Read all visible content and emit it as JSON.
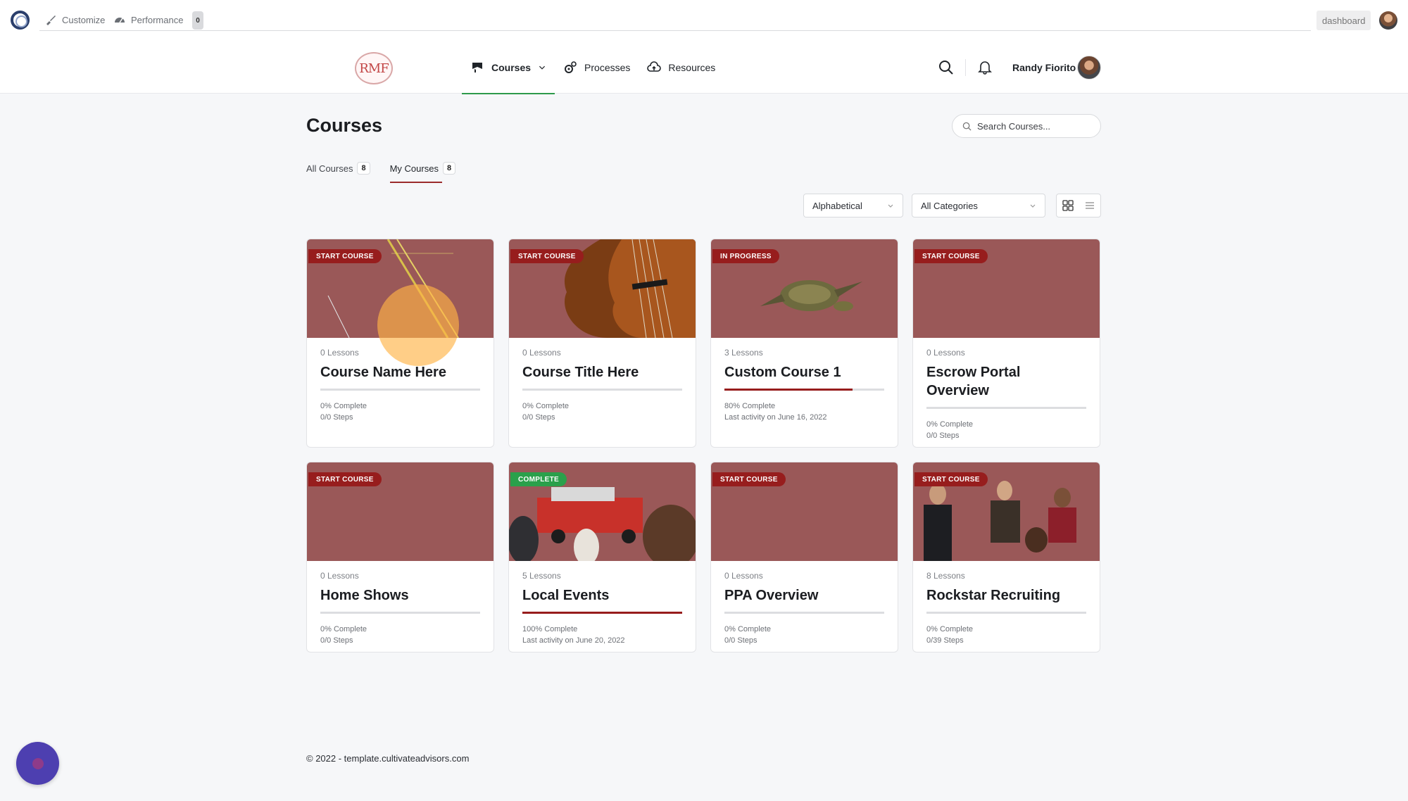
{
  "admin_bar": {
    "customize_label": "Customize",
    "performance_label": "Performance",
    "performance_count": "0",
    "dashboard_label": "dashboard"
  },
  "header": {
    "logo_text": "RMF",
    "nav": [
      {
        "label": "Courses",
        "icon": "courses-icon",
        "active": true
      },
      {
        "label": "Processes",
        "icon": "gears-icon"
      },
      {
        "label": "Resources",
        "icon": "cloud-upload-icon"
      }
    ],
    "user_name": "Randy Fiorito"
  },
  "page": {
    "title": "Courses",
    "search_placeholder": "Search Courses..."
  },
  "tabs": [
    {
      "label": "All Courses",
      "count": "8"
    },
    {
      "label": "My Courses",
      "count": "8",
      "active": true
    }
  ],
  "filters": {
    "sort_selected": "Alphabetical",
    "category_selected": "All Categories"
  },
  "courses": [
    {
      "badge": "START COURSE",
      "lessons": "0 Lessons",
      "title": "Course Name Here",
      "progress": 0,
      "status_line1": "0% Complete",
      "status_line2": "0/0 Steps",
      "thumb": "crane"
    },
    {
      "badge": "START COURSE",
      "lessons": "0 Lessons",
      "title": "Course Title Here",
      "progress": 0,
      "status_line1": "0% Complete",
      "status_line2": "0/0 Steps",
      "thumb": "violin"
    },
    {
      "badge": "IN PROGRESS",
      "lessons": "3 Lessons",
      "title": "Custom Course 1",
      "progress": 80,
      "status_line1": "80% Complete",
      "status_line2": "Last activity on June 16, 2022",
      "thumb": "turtle"
    },
    {
      "badge": "START COURSE",
      "lessons": "0 Lessons",
      "title": "Escrow Portal Overview",
      "progress": 0,
      "status_line1": "0% Complete",
      "status_line2": "0/0 Steps",
      "thumb": "plain"
    },
    {
      "badge": "START COURSE",
      "lessons": "0 Lessons",
      "title": "Home Shows",
      "progress": 0,
      "status_line1": "0% Complete",
      "status_line2": "0/0 Steps",
      "thumb": "plain"
    },
    {
      "badge": "COMPLETE",
      "lessons": "5 Lessons",
      "title": "Local Events",
      "progress": 100,
      "status_line1": "100% Complete",
      "status_line2": "Last activity on June 20, 2022",
      "thumb": "fire"
    },
    {
      "badge": "START COURSE",
      "lessons": "0 Lessons",
      "title": "PPA Overview",
      "progress": 0,
      "status_line1": "0% Complete",
      "status_line2": "0/0 Steps",
      "thumb": "plain"
    },
    {
      "badge": "START COURSE",
      "lessons": "8 Lessons",
      "title": "Rockstar Recruiting",
      "progress": 0,
      "status_line1": "0% Complete",
      "status_line2": "0/39 Steps",
      "thumb": "people"
    }
  ],
  "footer": {
    "text": "© 2022 - template.cultivateadvisors.com"
  },
  "colors": {
    "accent": "#971d1d",
    "complete": "#2aa04b",
    "nav_active": "#2e9a4b",
    "placeholder_thumb": "#9a5858"
  }
}
